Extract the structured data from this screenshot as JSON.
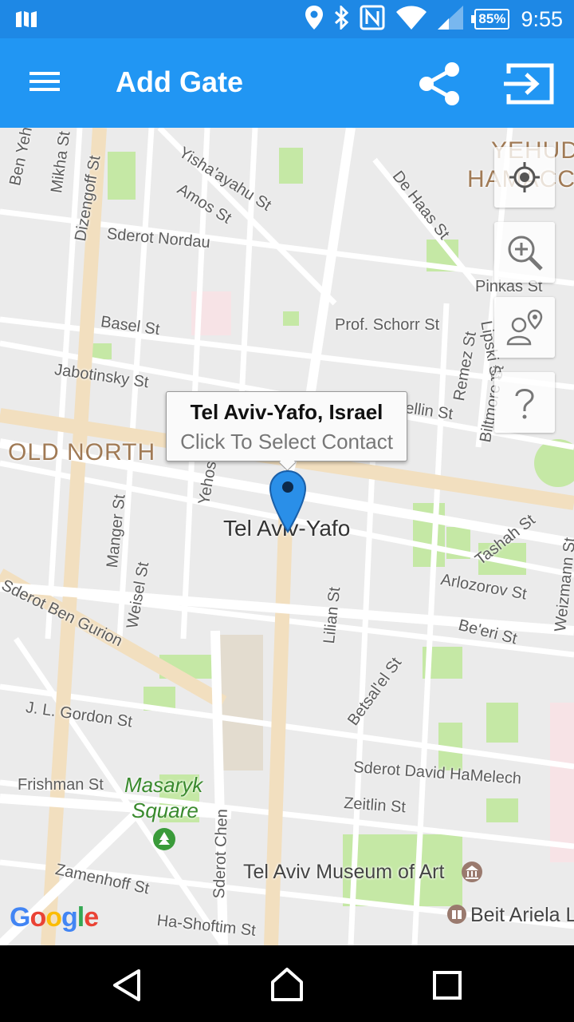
{
  "status_bar": {
    "battery": "85%",
    "time": "9:55",
    "icons": [
      "notification-icon",
      "location-icon",
      "bluetooth-icon",
      "nfc-icon",
      "wifi-icon",
      "signal-icon",
      "battery-icon"
    ]
  },
  "app_bar": {
    "title": "Add Gate",
    "menu_icon": "hamburger-menu-icon",
    "share_icon": "share-icon",
    "exit_icon": "exit-icon"
  },
  "map": {
    "info_window": {
      "title": "Tel Aviv-Yafo, Israel",
      "subtitle": "Click To Select Contact"
    },
    "city_label": "Tel Aviv-Yafo",
    "districts": {
      "old_north": "OLD NORTH",
      "yehuda_line1": "YEHUD",
      "yehuda_line2": "HAMACC"
    },
    "streets": {
      "ben_yehuda": "Ben Yehuda St",
      "mikha": "Mikha St",
      "dizengoff": "Dizengoff St",
      "yishayahu": "Yisha'ayahu St",
      "amos": "Amos St",
      "de_haas": "De Haas St",
      "nordau": "Sderot Nordau",
      "pinkas": "Pinkas St",
      "basel": "Basel St",
      "prof_schorr": "Prof. Schorr St",
      "remez": "Remez St",
      "jabotinsky": "Jabotinsky St",
      "ellin": "ellin St",
      "biltmore": "Biltmore St",
      "lipsky": "Lipski St",
      "manger": "Manger St",
      "weisel": "Weisel St",
      "yehoshua": "Yehos",
      "tashah": "Tashah St",
      "arlozorov": "Arlozorov St",
      "weizmann": "Weizmann St",
      "ben_gurion": "Sderot Ben Gurion",
      "lilian": "Lilian St",
      "beeri": "Be'eri St",
      "betsalel": "Betsal'el St",
      "gordon": "J. L. Gordon St",
      "david_hamelech": "Sderot David HaMelech",
      "frishman": "Frishman St",
      "zeitlin": "Zeitlin St",
      "sderot_chen": "Sderot Chen",
      "zamenhoff": "Zamenhoff St",
      "ha_shoftim": "Ha-Shoftim St"
    },
    "parks": {
      "masaryk_line1": "Masaryk",
      "masaryk_line2": "Square"
    },
    "pois": {
      "museum": "Tel Aviv Museum of Art",
      "beit_ariela": "Beit Ariela L"
    },
    "tools": [
      "my-location-icon",
      "zoom-icon",
      "contact-location-icon",
      "help-icon"
    ],
    "logo": "Google"
  },
  "nav_bar": {
    "buttons": [
      "back-icon",
      "home-icon",
      "recents-icon"
    ]
  },
  "colors": {
    "status_bar": "#1e88e5",
    "app_bar": "#2196f3",
    "pin": "#2a8fe8",
    "map_bg": "#ebebeb",
    "major_road": "#f2dfbf",
    "park": "#c5e8a5"
  }
}
